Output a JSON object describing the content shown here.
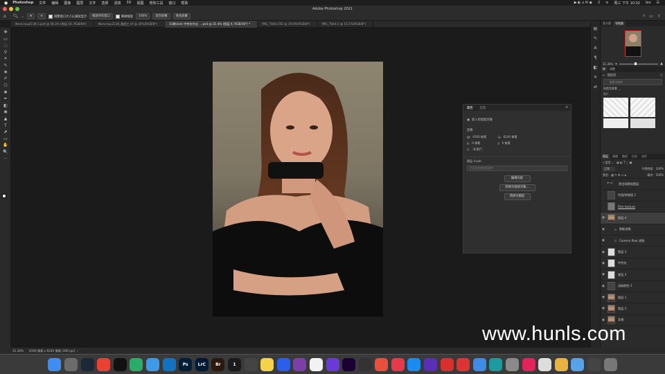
{
  "menubar": {
    "apple": "",
    "items": [
      "Photoshop",
      "文件",
      "编辑",
      "图像",
      "图层",
      "文字",
      "选择",
      "滤镜",
      "3D",
      "视图",
      "增效工具",
      "窗口",
      "帮助"
    ],
    "status_right": "周三 下午 10:02",
    "user": "leo",
    "battery_badge": "2"
  },
  "window": {
    "title": "Adobe Photoshop 2021"
  },
  "options": {
    "chk1": "调整窗口大小以满屏显示",
    "chk2": "缩放所有窗口",
    "chk3": "细微缩放",
    "zoom_value": "100%",
    "fit_screen": "适合屏幕",
    "fill_screen": "填充屏幕"
  },
  "tabs": [
    {
      "label": "Фильтры2136-1.psd @ 58.3% (图层 16, RGB/8#)",
      "active": false
    },
    {
      "label": "Фильтры2136_看图工.tif @ 30%(RGB/8*)",
      "active": false
    },
    {
      "label": "31期clark 中性灰作业 ....psd @ 31.4% (图层 4, RGB/16*) *",
      "active": true
    },
    {
      "label": "IMG_7044.CR2 @ 19.6%(RGB/8*)",
      "active": false
    },
    {
      "label": "IMG_7044-2 @ 15.5%(RGB/8*)",
      "active": false
    }
  ],
  "tools": [
    "✥",
    "▭",
    "◌",
    "⚲",
    "⌗",
    "✎",
    "✚",
    "✐",
    "⎔",
    "✱",
    "✒",
    "◧",
    "◉",
    "▲",
    "T",
    "⬈",
    "▭",
    "✋",
    "🔍",
    "···"
  ],
  "properties": {
    "tab1": "属性",
    "tab2": "信息",
    "smart_object_label": "嵌入的智能对象",
    "transform_label": "变换",
    "w_label": "W:",
    "w_value": "4160 像素",
    "h_label": "H:",
    "h_value": "6240 像素",
    "x_label": "X:",
    "x_value": "0 像素",
    "y_label": "Y:",
    "y_value": "0 像素",
    "angle_value": "0.00°",
    "file_label": "图层 4.psb",
    "file_placeholder": "不在任何其他文档中",
    "btn_edit": "编辑内容",
    "btn_convert_linked": "转换为链接对象...",
    "btn_convert_layer": "转换为图层"
  },
  "navigator": {
    "tab1": "直方图",
    "tab2": "导航器",
    "zoom": "31.36%"
  },
  "libraries": {
    "tab1": "库",
    "tab2": "调整",
    "my_library": "我的库",
    "search_placeholder": "搜索当前库",
    "sort": "按类型查看",
    "group": "图片"
  },
  "layers_panel": {
    "tabs": [
      "图层",
      "通道",
      "路径",
      "历史",
      "动作"
    ],
    "blend_mode": "正常",
    "opacity_label": "不透明度:",
    "opacity_value": "100%",
    "lock_label": "锁定:",
    "fill_label": "填充:",
    "fill_value": "100%",
    "layers": [
      {
        "name": "黑白观察组图层",
        "type": "group",
        "visible": false
      },
      {
        "name": "色相/饱和度 1",
        "type": "adjust",
        "visible": false
      },
      {
        "name": "Film texture",
        "type": "pixel",
        "visible": false
      },
      {
        "name": "图层 4",
        "type": "smart",
        "visible": true
      },
      {
        "name": "智能滤镜",
        "type": "filter",
        "visible": true
      },
      {
        "name": "Camera Raw 滤镜",
        "type": "filter",
        "visible": true
      },
      {
        "name": "图层 3",
        "type": "pixel",
        "visible": true
      },
      {
        "name": "中性灰",
        "type": "pixel",
        "visible": true
      },
      {
        "name": "图层 2",
        "type": "pixel",
        "visible": true
      },
      {
        "name": "选取颜色 1",
        "type": "adjust",
        "visible": true
      },
      {
        "name": "图层 1",
        "type": "pixel",
        "visible": true
      },
      {
        "name": "图层 5",
        "type": "pixel",
        "visible": true
      },
      {
        "name": "背景",
        "type": "pixel",
        "visible": true
      }
    ]
  },
  "statusbar": {
    "zoom": "31.36%",
    "doc_info": "4160 像素 x 6240 像素 (300 ppi)"
  },
  "dock_apps": [
    {
      "name": "Finder",
      "color": "#3d8ef0"
    },
    {
      "name": "Launchpad",
      "color": "#6b6b6b"
    },
    {
      "name": "Steam",
      "color": "#1b2838"
    },
    {
      "name": "Chrome",
      "color": "#e94235"
    },
    {
      "name": "QQ",
      "color": "#111"
    },
    {
      "name": "WeChat",
      "color": "#2aae67"
    },
    {
      "name": "Weibo",
      "color": "#3d9ae8"
    },
    {
      "name": "Edge",
      "color": "#1273c2"
    },
    {
      "name": "Ps",
      "color": "#001e36"
    },
    {
      "name": "LrC",
      "color": "#001a33"
    },
    {
      "name": "Br",
      "color": "#2b1a0c"
    },
    {
      "name": "1Password",
      "color": "#1a1a1a"
    },
    {
      "name": "DaVinci",
      "color": "#444"
    },
    {
      "name": "Notes",
      "color": "#f4d34b"
    },
    {
      "name": "Baidu",
      "color": "#2b5fea"
    },
    {
      "name": "Game",
      "color": "#7b3fa7"
    },
    {
      "name": "Photos",
      "color": "#f2f2f2"
    },
    {
      "name": "Affinity",
      "color": "#6a3ad9"
    },
    {
      "name": "Pr",
      "color": "#1a0033"
    },
    {
      "name": "FCP",
      "color": "#333"
    },
    {
      "name": "Mail",
      "color": "#ea4f3d"
    },
    {
      "name": "Music",
      "color": "#e8394b"
    },
    {
      "name": "AppStore",
      "color": "#1a8cf0"
    },
    {
      "name": "Affinity2",
      "color": "#5b2fb5"
    },
    {
      "name": "NetEase",
      "color": "#d9302d"
    },
    {
      "name": "RedApp",
      "color": "#d33"
    },
    {
      "name": "Swift",
      "color": "#3f8ce8"
    },
    {
      "name": "Word",
      "color": "#1c9aa0"
    },
    {
      "name": "Prefs",
      "color": "#8a8a8a"
    },
    {
      "name": "CC",
      "color": "#e2245b"
    },
    {
      "name": "Notes2",
      "color": "#ddd"
    },
    {
      "name": "Preview",
      "color": "#e9b33f"
    },
    {
      "name": "Folder",
      "color": "#5aa2e8"
    },
    {
      "name": "Screen",
      "color": "#444"
    },
    {
      "name": "Trash",
      "color": "#777"
    }
  ],
  "dock_labels": {
    "ps": "Ps",
    "lrc": "LrC",
    "br": "Br",
    "one": "1"
  },
  "watermark": "www.hunls.com"
}
